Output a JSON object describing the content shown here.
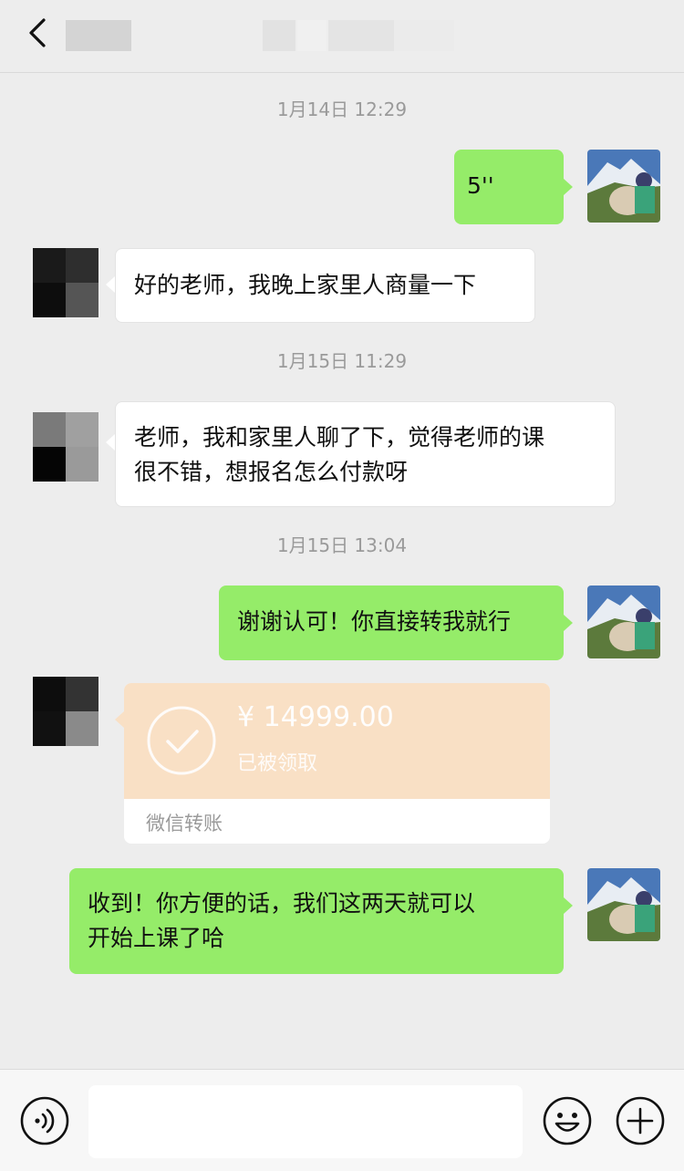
{
  "header": {
    "back_icon": "chevron-left-icon"
  },
  "messages": {
    "ts1": "1月14日 12:29",
    "m1": "5''",
    "m2": "好的老师，我晚上家里人商量一下",
    "ts2": "1月15日 11:29",
    "m3_line1": "老师，我和家里人聊了下，觉得老师的课",
    "m3_line2": "很不错，想报名怎么付款呀",
    "ts3": "1月15日 13:04",
    "m4": "谢谢认可！你直接转我就行",
    "transfer": {
      "currency": "¥",
      "amount": "14999.00",
      "status": "已被领取",
      "footer": "微信转账",
      "icon": "check-circle-icon"
    },
    "m5_line1": "收到！你方便的话，我们这两天就可以",
    "m5_line2": "开始上课了哈"
  },
  "input_bar": {
    "voice_icon": "voice-icon",
    "emoji_icon": "emoji-icon",
    "plus_icon": "plus-icon",
    "text_value": ""
  },
  "colors": {
    "background": "#ededed",
    "outgoing_bubble": "#95ec69",
    "incoming_bubble": "#ffffff",
    "transfer_card": "#f9e0c5"
  }
}
